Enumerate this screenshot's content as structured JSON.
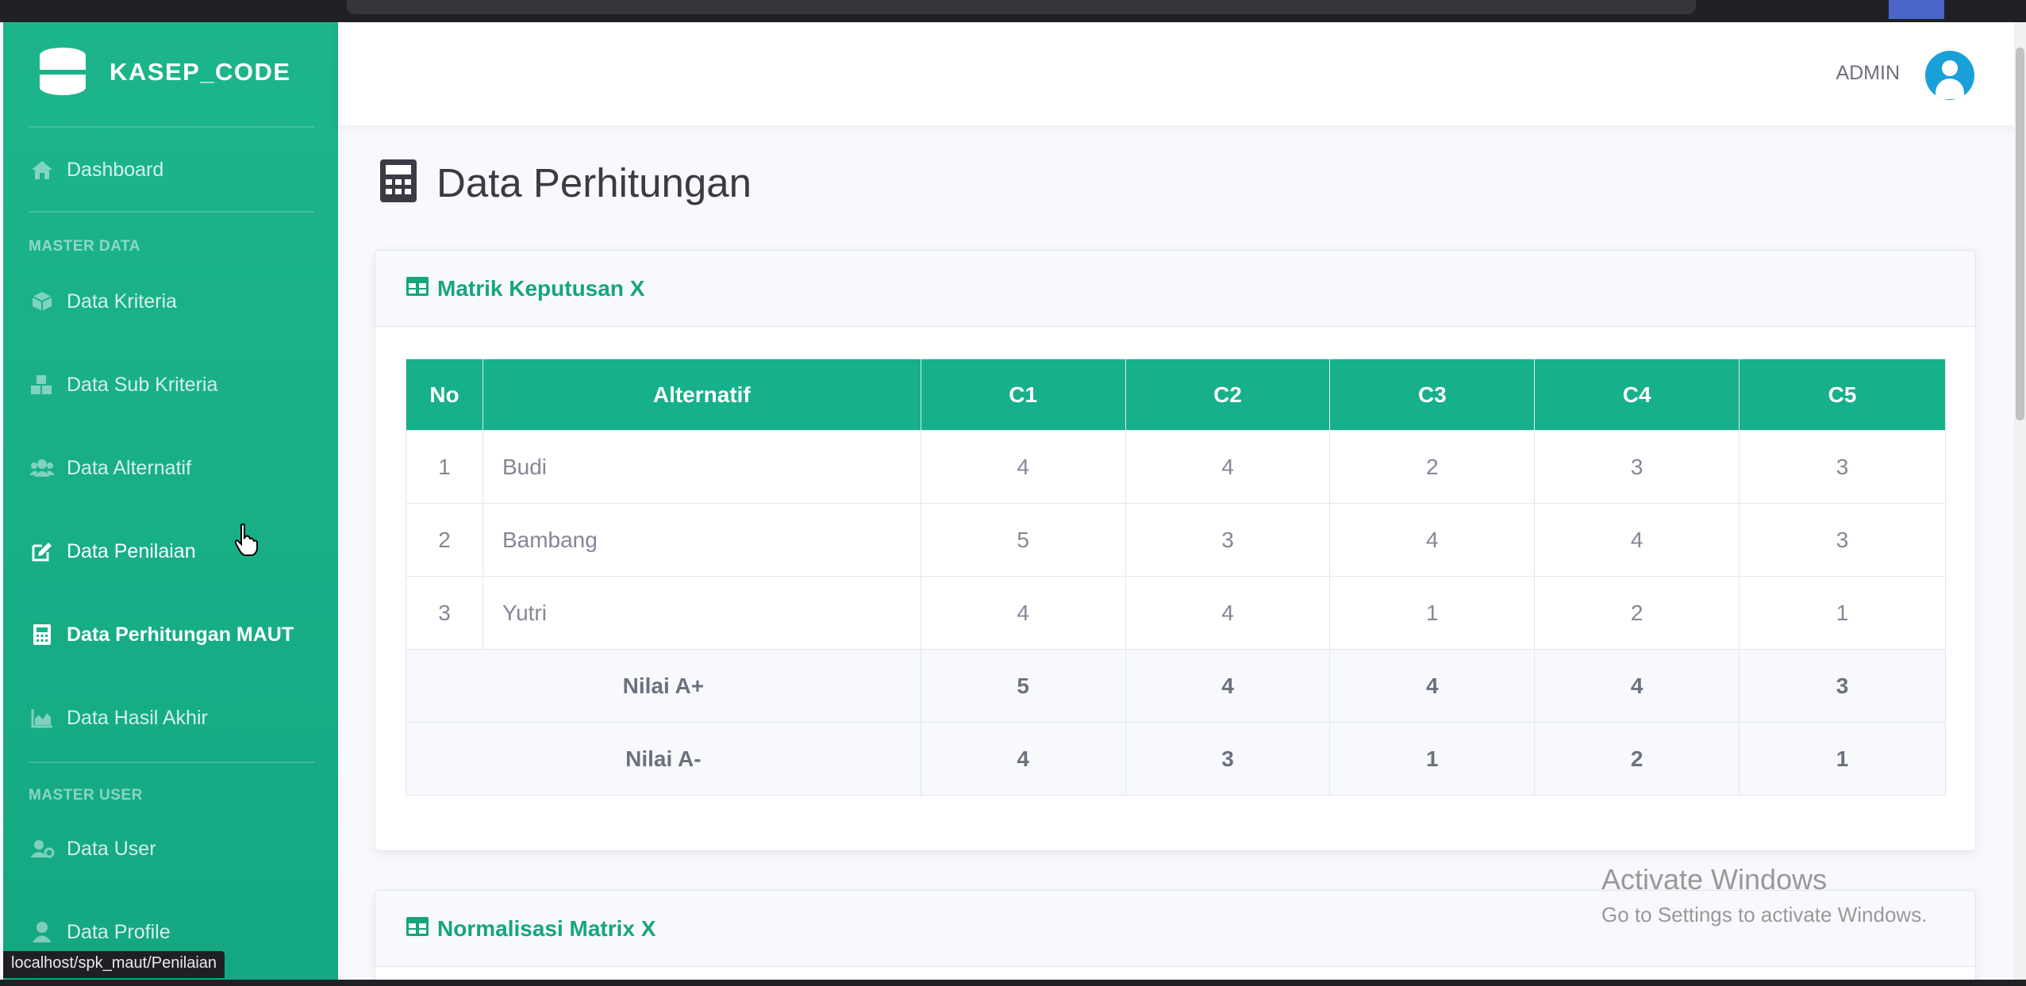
{
  "brand": {
    "name": "KASEP_CODE"
  },
  "sidebar": {
    "dashboard": "Dashboard",
    "heading_master_data": "MASTER DATA",
    "items": [
      {
        "label": "Data Kriteria",
        "icon": "cube-icon"
      },
      {
        "label": "Data Sub Kriteria",
        "icon": "cubes-icon"
      },
      {
        "label": "Data Alternatif",
        "icon": "users-icon"
      },
      {
        "label": "Data Penilaian",
        "icon": "edit-icon"
      },
      {
        "label": "Data Perhitungan MAUT",
        "icon": "calculator-icon"
      },
      {
        "label": "Data Hasil Akhir",
        "icon": "chart-area-icon"
      }
    ],
    "heading_master_user": "MASTER USER",
    "user_items": [
      {
        "label": "Data User",
        "icon": "users-cog-icon"
      },
      {
        "label": "Data Profile",
        "icon": "user-icon"
      }
    ]
  },
  "topbar": {
    "user_name": "ADMIN"
  },
  "page": {
    "title": "Data Perhitungan"
  },
  "card_matrix": {
    "title": "Matrik Keputusan X",
    "headers": [
      "No",
      "Alternatif",
      "C1",
      "C2",
      "C3",
      "C4",
      "C5"
    ],
    "rows": [
      {
        "no": "1",
        "name": "Budi",
        "values": [
          "4",
          "4",
          "2",
          "3",
          "3"
        ]
      },
      {
        "no": "2",
        "name": "Bambang",
        "values": [
          "5",
          "3",
          "4",
          "4",
          "3"
        ]
      },
      {
        "no": "3",
        "name": "Yutri",
        "values": [
          "4",
          "4",
          "1",
          "2",
          "1"
        ]
      }
    ],
    "max_row": {
      "label": "Nilai A+",
      "values": [
        "5",
        "4",
        "4",
        "4",
        "3"
      ]
    },
    "min_row": {
      "label": "Nilai A-",
      "values": [
        "4",
        "3",
        "1",
        "2",
        "1"
      ]
    }
  },
  "card_normalisasi": {
    "title": "Normalisasi Matrix X"
  },
  "status_bar": {
    "url": "localhost/spk_maut/Penilaian"
  },
  "windows_watermark": {
    "line1": "Activate Windows",
    "line2": "Go to Settings to activate Windows."
  },
  "colors": {
    "primary": "#16b08a",
    "title_text": "#3a3b45",
    "avatar": "#1aa0d8"
  }
}
